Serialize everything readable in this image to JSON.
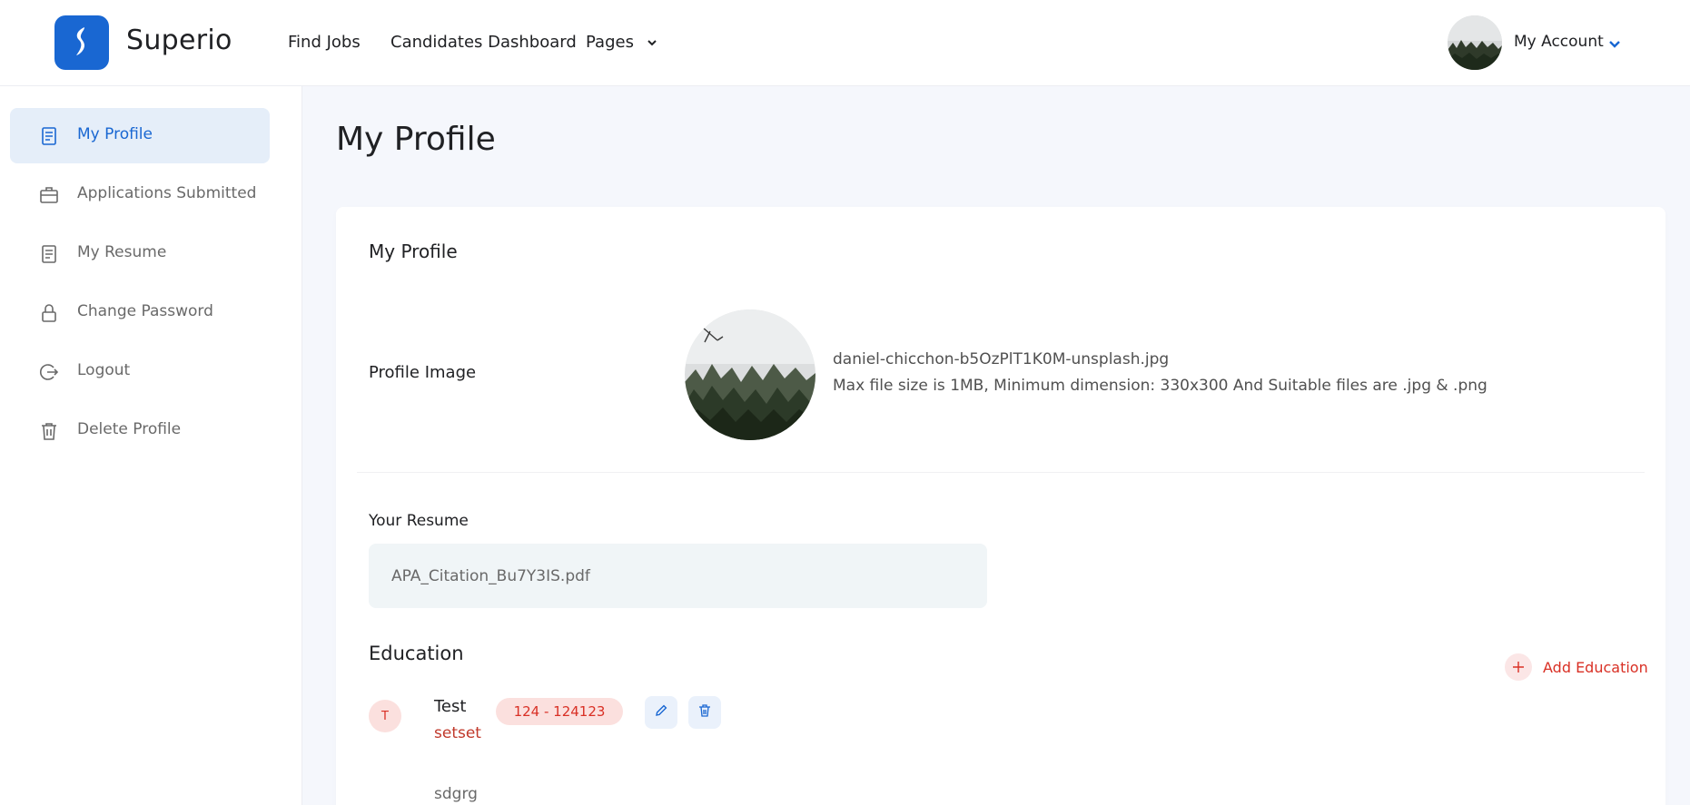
{
  "header": {
    "brand": "Superio",
    "nav": [
      {
        "label": "Find Jobs"
      },
      {
        "label": "Candidates Dashboard"
      },
      {
        "label": "Pages"
      }
    ],
    "account_label": "My Account"
  },
  "sidebar": {
    "items": [
      {
        "label": "My Profile",
        "icon": "document-icon",
        "active": true
      },
      {
        "label": "Applications Submitted",
        "icon": "briefcase-icon"
      },
      {
        "label": "My Resume",
        "icon": "resume-icon"
      },
      {
        "label": "Change Password",
        "icon": "lock-icon"
      },
      {
        "label": "Logout",
        "icon": "logout-icon"
      },
      {
        "label": "Delete Profile",
        "icon": "trash-icon"
      }
    ]
  },
  "main": {
    "page_title": "My Profile",
    "card_title": "My Profile",
    "profile_image_label": "Profile Image",
    "file_name": "daniel-chicchon-b5OzPlT1K0M-unsplash.jpg",
    "file_hint": "Max file size is 1MB, Minimum dimension: 330x300 And Suitable files are .jpg & .png",
    "resume_label": "Your Resume",
    "resume_value": "APA_Citation_Bu7Y3IS.pdf",
    "education_title": "Education",
    "add_education_label": "Add Education",
    "education": [
      {
        "marker": "T",
        "name": "Test",
        "years": "124 - 124123",
        "institution": "setset",
        "description": "sdgrg"
      }
    ]
  },
  "colors": {
    "primary": "#1967d2",
    "accent_red": "#d93025",
    "background": "#f5f7fc"
  }
}
